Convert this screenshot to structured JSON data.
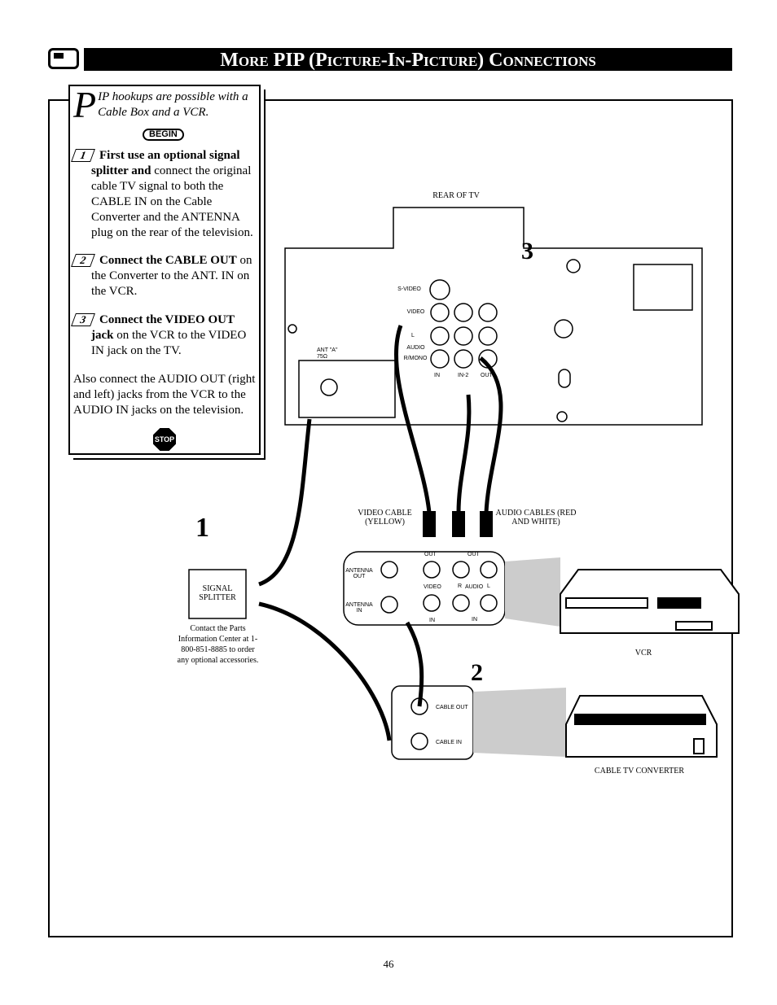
{
  "header": {
    "title": "More PIP (Picture-In-Picture) Connections",
    "icon": "tv-icon"
  },
  "panel": {
    "dropcap": "P",
    "intro": "IP hookups are possible with a Cable Box and a VCR.",
    "begin": "BEGIN",
    "steps": [
      {
        "num": "1",
        "bold": "First use an optional signal splitter and",
        "text": " connect the original cable TV signal to both the CABLE IN on the Cable Converter and the ANTENNA plug on the rear of the television."
      },
      {
        "num": "2",
        "bold": "Connect the CABLE OUT",
        "text": " on the Converter to the ANT. IN on the VCR."
      },
      {
        "num": "3",
        "bold": "Connect the VIDEO OUT jack",
        "text": " on the VCR to the VIDEO IN jack on the TV."
      }
    ],
    "note": "Also connect the AUDIO OUT (right and left) jacks from the VCR to the AUDIO IN jacks on the television.",
    "stop": "STOP"
  },
  "diagram": {
    "rear_of_tv": "REAR OF TV",
    "tv": {
      "svideo": "S-VIDEO",
      "video": "VIDEO",
      "l": "L",
      "audio": "AUDIO",
      "rmono": "R/MONO",
      "in": "IN",
      "in2": "IN-2",
      "out": "OUT",
      "ant": "ANT \"A\"",
      "ohm": "75Ω"
    },
    "video_cable": "VIDEO CABLE (YELLOW)",
    "audio_cables": "AUDIO CABLES (RED AND WHITE)",
    "vcr_panel": {
      "antenna_out": "ANTENNA OUT",
      "antenna_in": "ANTENNA IN",
      "out1": "OUT",
      "out2": "OUT",
      "video": "VIDEO",
      "r": "R",
      "audio": "AUDIO",
      "l": "L",
      "in1": "IN",
      "in2": "IN"
    },
    "splitter": "SIGNAL SPLITTER",
    "contact": "Contact the Parts Information Center at 1-800-851-8885 to order any optional accessories.",
    "vcr": "VCR",
    "converter_panel": {
      "cable_out": "CABLE OUT",
      "cable_in": "CABLE IN"
    },
    "converter": "CABLE TV CONVERTER",
    "callouts": [
      "1",
      "2",
      "3"
    ]
  },
  "page_number": "46"
}
